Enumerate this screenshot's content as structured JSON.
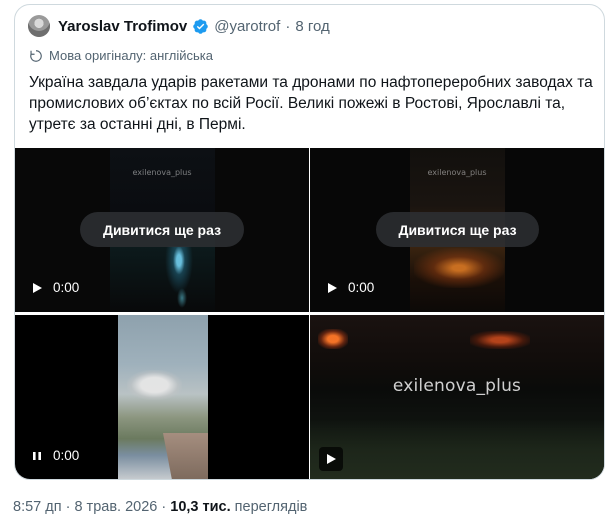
{
  "quoted_tweet": {
    "author_name": "Yaroslav Trofimov",
    "handle": "@yarotrof",
    "separator": "·",
    "time": "8 год",
    "translation_note": "Мова оригіналу: англійська",
    "text": "Україна завдала ударів ракетами та дронами по нафтопереробних заводах та промислових об’єктах по всій Росії. Великі пожежі в Ростові, Ярославлі та, утретє за останні дні, в Пермі.",
    "media": [
      {
        "replay_label": "Дивитися ще раз",
        "time": "0:00",
        "state": "ended",
        "watermark": "exilenova_plus"
      },
      {
        "replay_label": "Дивитися ще раз",
        "time": "0:00",
        "state": "ended",
        "watermark": "exilenova_plus"
      },
      {
        "time": "0:00",
        "state": "paused"
      },
      {
        "watermark": "exilenova_plus",
        "state": "gif-play"
      }
    ]
  },
  "footer": {
    "time": "8:57 дп",
    "separator": "·",
    "date": "8 трав. 2026",
    "views_count": "10,3 тис.",
    "views_label": "переглядів"
  },
  "colors": {
    "text_primary": "#0f1419",
    "text_secondary": "#536471",
    "border": "#cfd9de",
    "verified_badge": "#1d9bf0"
  },
  "icons": {
    "verified": "verified-badge-icon",
    "translate": "translate-icon",
    "play": "play-icon",
    "pause": "pause-icon"
  }
}
